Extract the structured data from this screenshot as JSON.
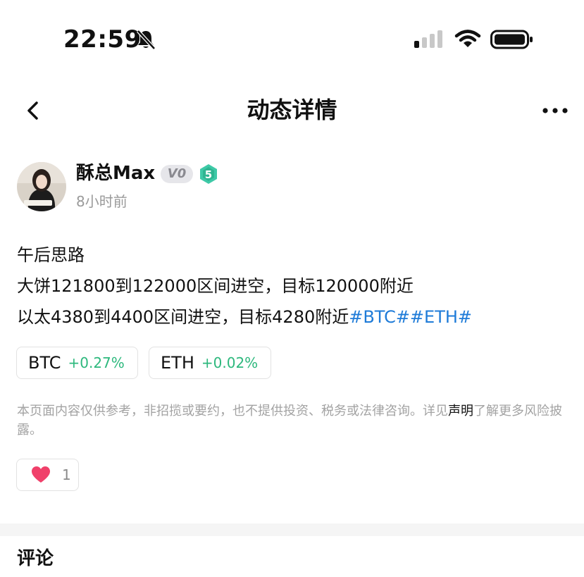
{
  "status_bar": {
    "time": "22:59"
  },
  "nav": {
    "title": "动态详情"
  },
  "user": {
    "name": "酥总Max",
    "vip_badge": "V0",
    "level": "5",
    "post_time": "8小时前"
  },
  "post": {
    "line1": "午后思路",
    "line2": "大饼121800到122000区间进空，目标120000附近",
    "line3": "以太4380到4400区间进空，目标4280附近",
    "hashtags": "#BTC##ETH#"
  },
  "tickers": [
    {
      "symbol": "BTC",
      "change": "+0.27%"
    },
    {
      "symbol": "ETH",
      "change": "+0.02%"
    }
  ],
  "disclaimer": {
    "text_before": "本页面内容仅供参考，非招揽或要约，也不提供投资、税务或法律咨询。详见",
    "link": "声明",
    "text_after": "了解更多风险披露。"
  },
  "like": {
    "count": "1"
  },
  "comments": {
    "title": "评论"
  },
  "colors": {
    "accent_up": "#2db87d",
    "hashtag": "#1e7bd8",
    "heart": "#f0406a",
    "level_badge": "#3ec9a7"
  }
}
